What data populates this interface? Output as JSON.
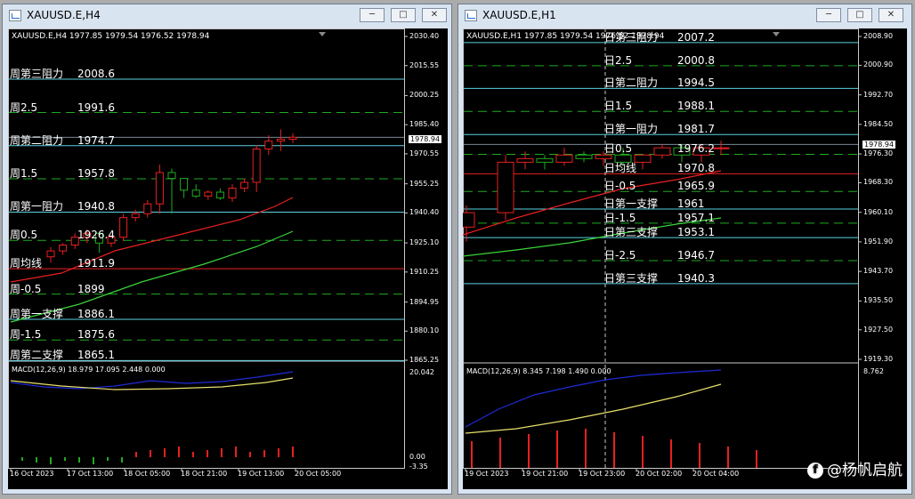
{
  "windows": [
    {
      "title": "XAUUSD.E,H4",
      "header": "XAUUSD.E,H4  1977.85 1979.54 1976.52 1978.94",
      "price_axis": [
        "2030.40",
        "2015.55",
        "2000.25",
        "1985.40",
        "1970.55",
        "1955.25",
        "1940.40",
        "1925.10",
        "1910.25",
        "1894.95",
        "1880.10",
        "1865.25"
      ],
      "current_price": "1978.94",
      "levels": [
        {
          "name": "周第三阻力",
          "value": "2008.6"
        },
        {
          "name": "周2.5",
          "value": "1991.6"
        },
        {
          "name": "周第二阻力",
          "value": "1974.7"
        },
        {
          "name": "周1.5",
          "value": "1957.8"
        },
        {
          "name": "周第一阻力",
          "value": "1940.8"
        },
        {
          "name": "周0.5",
          "value": "1926.4"
        },
        {
          "name": "周均线",
          "value": "1911.9"
        },
        {
          "name": "周-0.5",
          "value": "1899"
        },
        {
          "name": "周第一支撑",
          "value": "1886.1"
        },
        {
          "name": "周-1.5",
          "value": "1875.6"
        },
        {
          "name": "周第二支撑",
          "value": "1865.1"
        }
      ],
      "macd_header": "MACD(12,26,9) 18.979 17.095 2.448 0.000",
      "macd_axis": [
        "20.042",
        "0.00",
        "-3.35"
      ],
      "time_axis": [
        "16 Oct 2023",
        "17 Oct 13:00",
        "18 Oct 05:00",
        "18 Oct 21:00",
        "19 Oct 13:00",
        "20 Oct 05:00"
      ]
    },
    {
      "title": "XAUUSD.E,H1",
      "header": "XAUUSD.E,H1  1977.85 1979.54 1976.52 1978.94",
      "price_axis": [
        "2008.90",
        "2000.90",
        "1992.70",
        "1984.50",
        "1976.30",
        "1968.30",
        "1960.10",
        "1951.90",
        "1943.70",
        "1935.50",
        "1927.50",
        "1919.30"
      ],
      "current_price": "1978.94",
      "levels": [
        {
          "name": "日第三阻力",
          "value": "2007.2"
        },
        {
          "name": "日2.5",
          "value": "2000.8"
        },
        {
          "name": "日第二阻力",
          "value": "1994.5"
        },
        {
          "name": "日1.5",
          "value": "1988.1"
        },
        {
          "name": "日第一阻力",
          "value": "1981.7"
        },
        {
          "name": "日0.5",
          "value": "1976.2"
        },
        {
          "name": "日均线",
          "value": "1970.8"
        },
        {
          "name": "日-0.5",
          "value": "1965.9"
        },
        {
          "name": "日第一支撑",
          "value": "1961"
        },
        {
          "name": "日-1.5",
          "value": "1957.1"
        },
        {
          "name": "日第三支撑",
          "value": "1953.1"
        },
        {
          "name": "日-2.5",
          "value": "1946.7"
        },
        {
          "name": "日第三支撑",
          "value": "1940.3"
        }
      ],
      "macd_header": "MACD(12,26,9) 8.345 7.198 1.490 0.000",
      "macd_axis": [
        "8.762"
      ],
      "time_axis": [
        "19 Oct 2023",
        "19 Oct 21:00",
        "19 Oct 23:00",
        "20 Oct 02:00",
        "20 Oct 04:00"
      ]
    }
  ],
  "watermark": "@杨帆启航",
  "watermark_icon": "facebook-icon"
}
